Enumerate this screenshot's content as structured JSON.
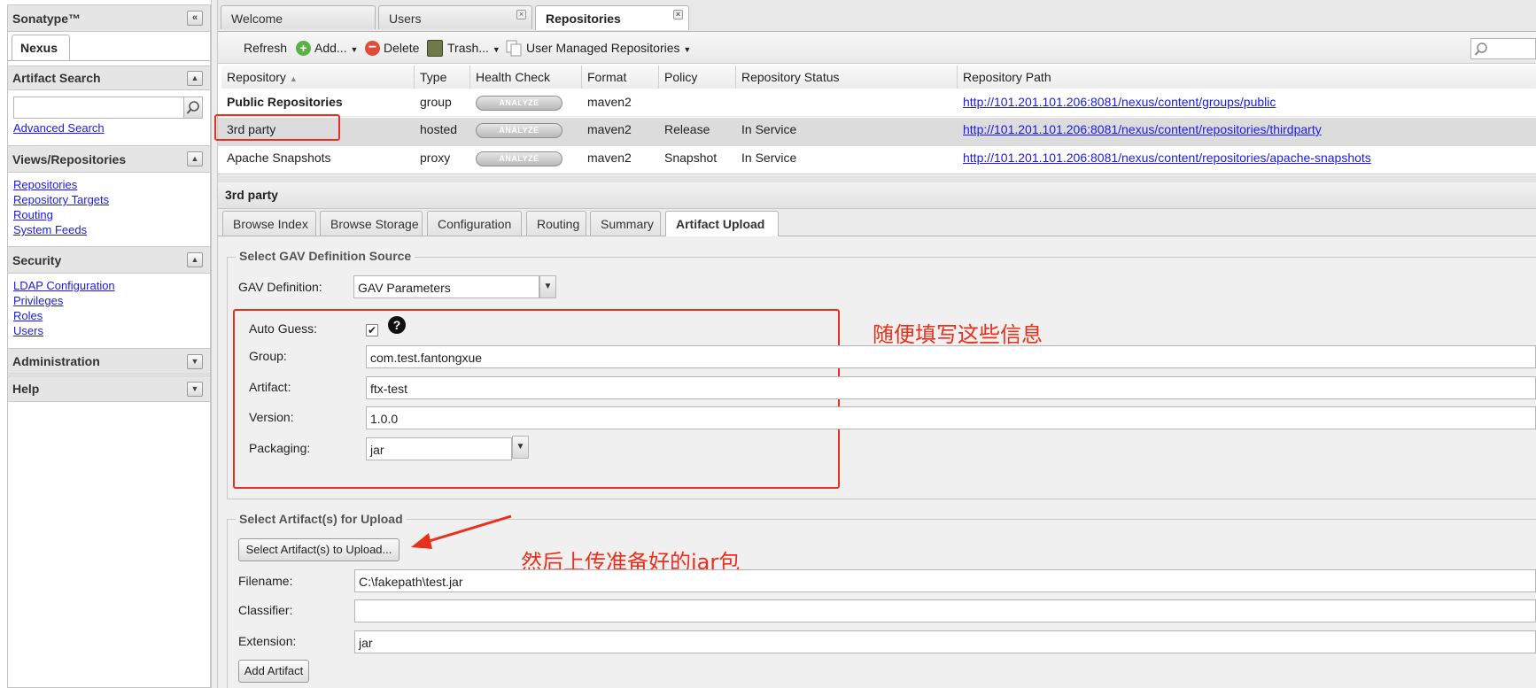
{
  "sidebar": {
    "title": "Sonatype™",
    "tab": "Nexus",
    "sections": [
      {
        "title": "Artifact Search",
        "links": [
          "Advanced Search"
        ]
      },
      {
        "title": "Views/Repositories",
        "links": [
          "Repositories",
          "Repository Targets",
          "Routing",
          "System Feeds"
        ]
      },
      {
        "title": "Security",
        "links": [
          "LDAP Configuration",
          "Privileges",
          "Roles",
          "Users"
        ]
      },
      {
        "title": "Administration",
        "links": []
      },
      {
        "title": "Help",
        "links": []
      }
    ]
  },
  "tabs": [
    "Welcome",
    "Users",
    "Repositories"
  ],
  "toolbar": {
    "refresh": "Refresh",
    "add": "Add...",
    "delete": "Delete",
    "trash": "Trash...",
    "user_managed": "User Managed Repositories"
  },
  "grid": {
    "columns": [
      "Repository",
      "Type",
      "Health Check",
      "Format",
      "Policy",
      "Repository Status",
      "Repository Path"
    ],
    "analyze_label": "ANALYZE",
    "rows": [
      {
        "name": "Public Repositories",
        "type": "group",
        "format": "maven2",
        "policy": "",
        "status": "",
        "path": "http://101.201.101.206:8081/nexus/content/groups/public"
      },
      {
        "name": "3rd party",
        "type": "hosted",
        "format": "maven2",
        "policy": "Release",
        "status": "In Service",
        "path": "http://101.201.101.206:8081/nexus/content/repositories/thirdparty"
      },
      {
        "name": "Apache Snapshots",
        "type": "proxy",
        "format": "maven2",
        "policy": "Snapshot",
        "status": "In Service",
        "path": "http://101.201.101.206:8081/nexus/content/repositories/apache-snapshots"
      }
    ]
  },
  "detail": {
    "title": "3rd party",
    "subtabs": [
      "Browse Index",
      "Browse Storage",
      "Configuration",
      "Routing",
      "Summary",
      "Artifact Upload"
    ]
  },
  "gav": {
    "legend": "Select GAV Definition Source",
    "definition_label": "GAV Definition:",
    "definition_value": "GAV Parameters",
    "auto_guess_label": "Auto Guess:",
    "auto_guess_checked": true,
    "group_label": "Group:",
    "group_value": "com.test.fantongxue",
    "artifact_label": "Artifact:",
    "artifact_value": "ftx-test",
    "version_label": "Version:",
    "version_value": "1.0.0",
    "packaging_label": "Packaging:",
    "packaging_value": "jar"
  },
  "upload": {
    "legend": "Select Artifact(s) for Upload",
    "select_button": "Select Artifact(s) to Upload...",
    "filename_label": "Filename:",
    "filename_value": "C:\\fakepath\\test.jar",
    "classifier_label": "Classifier:",
    "classifier_value": "",
    "extension_label": "Extension:",
    "extension_value": "jar",
    "add_button": "Add Artifact"
  },
  "annotations": {
    "note1": "随便填写这些信息",
    "note2": "然后上传准备好的jar包"
  },
  "colors": {
    "annotation_red": "#e8301c",
    "link_blue": "#1a1ae6",
    "selected_row": "#dcdcdc"
  }
}
